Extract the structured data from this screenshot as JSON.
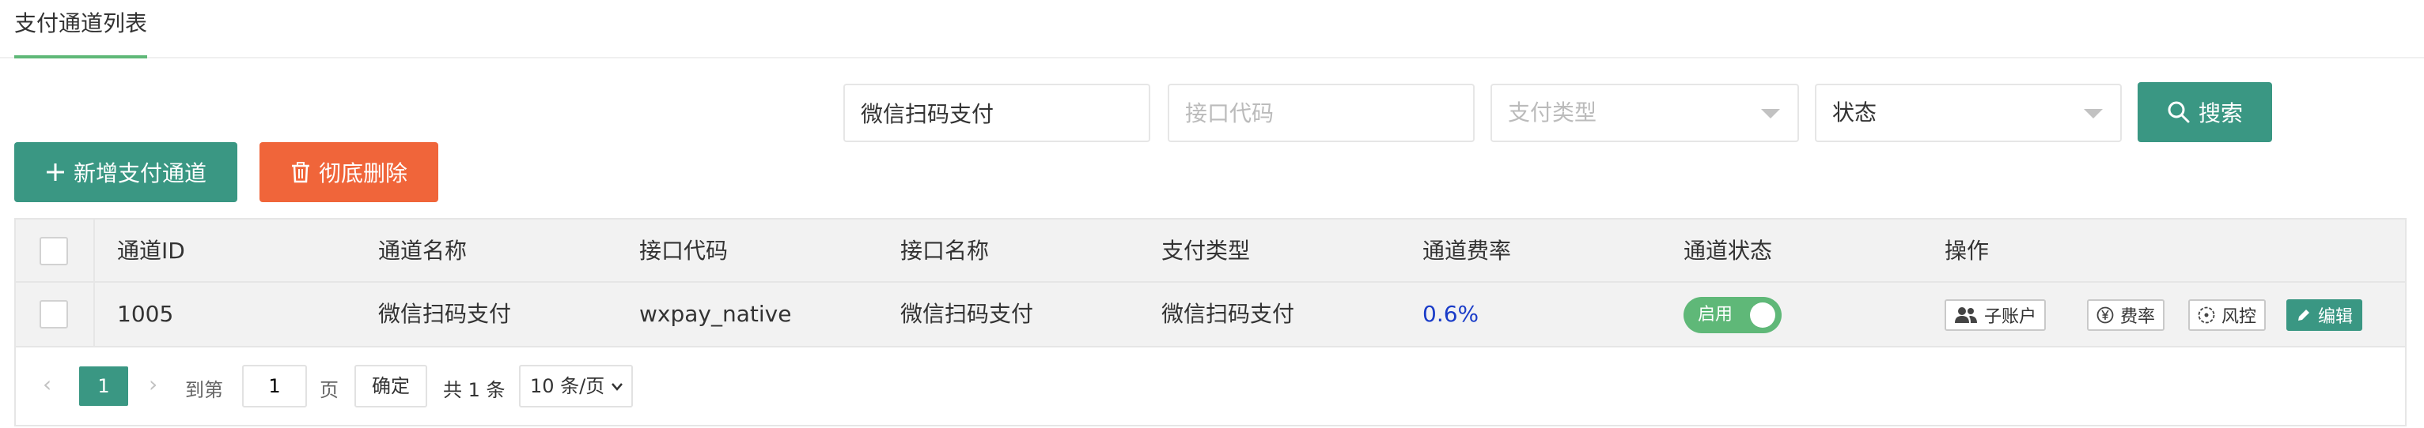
{
  "page_tab": "支付通道列表",
  "search": {
    "name_value": "微信扫码支付",
    "code_placeholder": "接口代码",
    "pay_type_placeholder": "支付类型",
    "status_value": "状态",
    "search_label": "搜索"
  },
  "actions": {
    "add_label": "新增支付通道",
    "delete_label": "彻底删除"
  },
  "table": {
    "columns": [
      "通道ID",
      "通道名称",
      "接口代码",
      "接口名称",
      "支付类型",
      "通道费率",
      "通道状态",
      "操作"
    ],
    "rows": [
      {
        "id": "1005",
        "name": "微信扫码支付",
        "code": "wxpay_native",
        "iface_name": "微信扫码支付",
        "pay_type": "微信扫码支付",
        "rate": "0.6%",
        "status": "启用",
        "ops": {
          "sub_account": "子账户",
          "fee": "费率",
          "risk": "风控",
          "edit": "编辑"
        }
      }
    ]
  },
  "pager": {
    "current_page": "1",
    "goto_label": "到第",
    "goto_value": "1",
    "page_unit": "页",
    "confirm_label": "确定",
    "total_text": "共 1 条",
    "page_size": "10 条/页"
  },
  "colors": {
    "primary": "#3a9783",
    "danger": "#f0653a",
    "toggle_on": "#5fb878",
    "rate_text": "#1a3cc8"
  }
}
